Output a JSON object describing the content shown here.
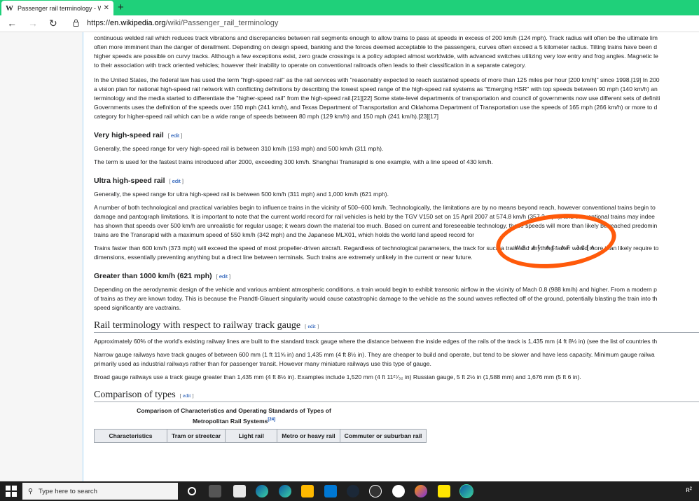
{
  "browser": {
    "tab_title": "Passenger rail terminology - Wiki",
    "tab_logo": "W",
    "url_domain": "en.wikipedia.org",
    "url_prefix": "https://",
    "url_path": "/wiki/Passenger_rail_terminology"
  },
  "article": {
    "intro_lines": [
      "continuous welded rail which reduces track vibrations and discrepancies between rail segments enough to allow trains to pass at speeds in excess of 200 km/h (124 mph). Track radius will often be the ultimate lim",
      "often more imminent than the danger of derailment. Depending on design speed, banking and the forces deemed acceptable to the passengers, curves often exceed a 5 kilometer radius. Tilting trains have been d",
      "higher speeds are possible on curvy tracks. Although a few exceptions exist, zero grade crossings is a policy adopted almost worldwide, with advanced switches utilizing very low entry and frog angles. Magnetic le",
      "to their association with track oriented vehicles; however their inability to operate on conventional railroads often leads to their classification in a separate category."
    ],
    "us_lines": [
      "In the United States, the federal law has used the term \"high-speed rail\" as the rail services with \"reasonably expected to reach sustained speeds of more than 125 miles per hour [200 km/h]\" since 1998.[19] In 200",
      "a vision plan for national high-speed rail network with conflicting definitions by describing the lowest speed range of the high-speed rail systems as \"Emerging HSR\" with top speeds between 90 mph (140 km/h) an",
      "terminology and the media started to differentiate the \"higher-speed rail\" from the high-speed rail.[21][22] Some state-level departments of transportation and council of governments now use different sets of definiti",
      "Governments uses the definition of the speeds over 150 mph (241 km/h), and Texas Department of Transportation and Oklahoma Department of Transportation use the speeds of 165 mph (266 km/h) or more to d",
      "category for higher-speed rail which can be a wide range of speeds between 80 mph (129 km/h) and 150 mph (241 km/h).[23][17]"
    ],
    "vhs": {
      "heading": "Very high-speed rail",
      "edit": "edit",
      "p1": "Generally, the speed range for very high-speed rail is between 310 km/h (193 mph) and 500 km/h (311 mph).",
      "p2": "The term is used for the fastest trains introduced after 2000, exceeding 300 km/h. Shanghai Transrapid is one example, with a line speed of 430 km/h."
    },
    "uhs": {
      "heading": "Ultra high-speed rail",
      "edit": "edit",
      "p1": "Generally, the speed range for ultra high-speed rail is between 500 km/h (311 mph) and 1,000 km/h (621 mph).",
      "p2_lines": [
        "A number of both technological and practical variables begin to influence trains in the vicinity of 500–600 km/h. Technologically, the limitations are by no means beyond reach, however conventional trains begin to",
        "damage and pantograph limitations. It is important to note that the current world record for rail vehicles is held by the TGV V150 set on 15 April 2007 at 574.8 km/h (357.2 mph), and conventional trains may indee",
        "has shown that speeds over 500 km/h are unrealistic for regular usage; it wears down the material too much. Based on current and foreseeable technology, these speeds will more than likely be reached predomin",
        "trains are the Transrapid with a maximum speed of 550 km/h (342 mph) and the Japanese MLX01, which holds the world land speed record for"
      ],
      "p3_lines": [
        "Trains faster than 600 km/h (373 mph) will exceed the speed of most propeller-driven aircraft. Regardless of technological parameters, the track for such a train and anything faster would more than likely require to",
        "dimensions, essentially preventing anything but a direct line between terminals. Such trains are extremely unlikely in the current or near future."
      ]
    },
    "gt1000": {
      "heading": "Greater than 1000 km/h (621 mph)",
      "edit": "edit",
      "lines": [
        "Depending on the aerodynamic design of the vehicle and various ambient atmospheric conditions, a train would begin to exhibit transonic airflow in the vicinity of Mach 0.8 (988 km/h) and higher. From a modern p",
        "of trains as they are known today. This is because the Prandtl-Glauert singularity would cause catastrophic damage to the vehicle as the sound waves reflected off of the ground, potentially blasting the train into th",
        "speed significantly are vactrains."
      ]
    },
    "gauge": {
      "heading": "Rail terminology with respect to railway track gauge",
      "edit": "edit",
      "p1": "Approximately 60% of the world's existing railway lines are built to the standard track gauge where the distance between the inside edges of the rails of the track is 1,435 mm (4 ft 8½ in) (see the list of countries th",
      "p2_lines": [
        "Narrow gauge railways have track gauges of between 600 mm (1 ft 11⅝ in) and 1,435 mm (4 ft 8½ in). They are cheaper to build and operate, but tend to be slower and have less capacity. Minimum gauge railwa",
        "primarily used as industrial railways rather than for passenger transit. However many miniature railways use this type of gauge."
      ],
      "p3": "Broad gauge railways use a track gauge greater than 1,435 mm (4 ft 8½ in). Examples include 1,520 mm (4 ft 11²⁷⁄₃₂ in) Russian gauge, 5 ft 2½ in (1,588 mm) and 1,676 mm (5 ft 6 in)."
    },
    "comparison": {
      "heading": "Comparison of types",
      "edit": "edit",
      "caption": "Comparison of Characteristics and Operating Standards of Types of Metropolitan Rail Systems",
      "caption_ref": "[24]",
      "headers": [
        "Characteristics",
        "Tram or streetcar",
        "Light rail",
        "Metro or heavy rail",
        "Commuter or suburban rail"
      ]
    }
  },
  "annotation": {
    "scrawl": "ᴡꜱ·ᴧt ᴧɛ   ᴧꜰ  ᴊcʈᴧ"
  },
  "taskbar": {
    "search_placeholder": "Type here to search",
    "tray_text": "ʀ²"
  },
  "colors": {
    "tab_bar": "#1fd07a",
    "link": "#0645ad",
    "annotation": "#ff5a0a",
    "taskbar": "#1f1f1f"
  }
}
